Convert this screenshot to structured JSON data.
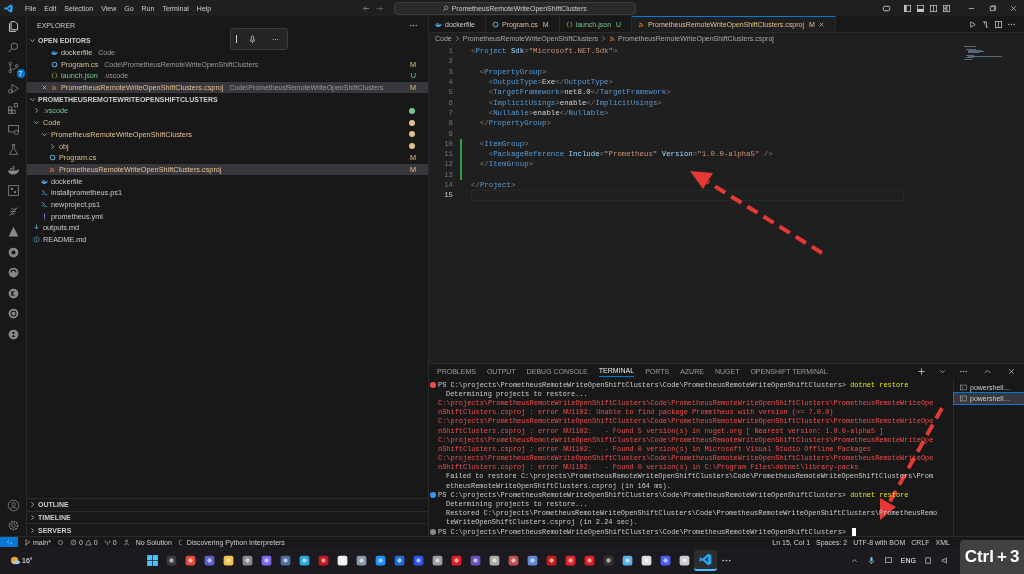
{
  "title_bar": {
    "menu": [
      "File",
      "Edit",
      "Selection",
      "View",
      "Go",
      "Run",
      "Terminal",
      "Help"
    ],
    "search": {
      "value": "PrometheusRemoteWriteOpenShiftClusters"
    }
  },
  "activity_bar": {
    "source_control_badge": "7"
  },
  "sidebar": {
    "title": "EXPLORER",
    "open_editors": {
      "title": "OPEN EDITORS",
      "expanded": true,
      "items": [
        {
          "label": "dockerfile",
          "description": "Code",
          "kind": "docker",
          "selected": false
        },
        {
          "label": "Program.cs",
          "description": "Code\\PrometheusRemoteWriteOpenShiftClusters",
          "kind": "csharp",
          "untracked": false,
          "badge": "M",
          "selected": false
        },
        {
          "label": "launch.json",
          "description": ".vscode",
          "kind": "json",
          "untracked": true,
          "badge": "U",
          "selected": false
        },
        {
          "label": "PrometheusRemoteWriteOpenShiftClusters.csproj",
          "description": "Code\\PrometheusRemoteWriteOpenShiftClusters",
          "kind": "xml",
          "untracked": false,
          "badge": "M",
          "selected": true
        }
      ]
    },
    "workspace": {
      "title": "PROMETHEUSREMOTEWRITEOPENSHIFTCLUSTERS",
      "expanded": true,
      "tree": [
        {
          "label": ".vscode",
          "kind": "folder",
          "expanded": false,
          "color": "#73c991",
          "selected": false
        },
        {
          "label": "Code",
          "kind": "folder",
          "expanded": true,
          "color": "#e2c08d",
          "selected": false,
          "children": [
            {
              "label": "PrometheusRemoteWriteOpenShiftClusters",
              "kind": "folder",
              "expanded": true,
              "color": "#e2c08d",
              "selected": false,
              "children": [
                {
                  "label": "obj",
                  "kind": "folder",
                  "expanded": false,
                  "color": "#e2c08d",
                  "selected": false
                },
                {
                  "label": "Program.cs",
                  "kind": "csharp",
                  "untracked": false,
                  "badge": "M",
                  "selected": false
                },
                {
                  "label": "PrometheusRemoteWriteOpenShiftClusters.csproj",
                  "kind": "xml",
                  "untracked": false,
                  "badge": "M",
                  "selected": true
                }
              ]
            },
            {
              "label": "dockerfile",
              "kind": "docker",
              "selected": false
            },
            {
              "label": "installprometheus.ps1",
              "kind": "powershell",
              "selected": false
            },
            {
              "label": "newproject.ps1",
              "kind": "powershell",
              "selected": false
            },
            {
              "label": "prometheus.yml",
              "kind": "yaml",
              "selected": false
            }
          ]
        },
        {
          "label": "outputs.md",
          "kind": "markdown",
          "selected": false
        },
        {
          "label": "README.md",
          "kind": "readme",
          "selected": false
        }
      ]
    },
    "sections": [
      {
        "title": "OUTLINE",
        "expanded": false
      },
      {
        "title": "TIMELINE",
        "expanded": false
      },
      {
        "title": "SERVERS",
        "expanded": false
      }
    ]
  },
  "editor": {
    "tabs": [
      {
        "label": "dockerfile",
        "kind": "docker",
        "selected": false
      },
      {
        "label": "Program.cs",
        "kind": "csharp",
        "untracked": false,
        "badge": "M",
        "selected": false
      },
      {
        "label": "launch.json",
        "kind": "json",
        "untracked": true,
        "badge": "U",
        "selected": false
      },
      {
        "label": "PrometheusRemoteWriteOpenShiftClusters.csproj",
        "kind": "xml",
        "untracked": false,
        "badge": "M",
        "selected": true
      }
    ],
    "breadcrumbs": [
      "Code",
      "PrometheusRemoteWriteOpenShiftClusters",
      "PrometheusRemoteWriteOpenShiftClusters.csproj"
    ],
    "lines": [
      {
        "number": "1",
        "changed": false,
        "current": false,
        "tokens": [
          {
            "kind": "punct",
            "text": "<"
          },
          {
            "kind": "tag",
            "text": "Project"
          },
          {
            "kind": "attr",
            "text": " Sdk"
          },
          {
            "kind": "punct",
            "text": "="
          },
          {
            "kind": "string",
            "text": "\"Microsoft.NET.Sdk\""
          },
          {
            "kind": "punct",
            "text": ">"
          }
        ]
      },
      {
        "number": "2",
        "changed": false,
        "current": false
      },
      {
        "number": "3",
        "changed": false,
        "current": false,
        "tokens": [
          {
            "kind": "punct",
            "text": "  <"
          },
          {
            "kind": "tag",
            "text": "PropertyGroup"
          },
          {
            "kind": "punct",
            "text": ">"
          }
        ]
      },
      {
        "number": "4",
        "changed": false,
        "current": false,
        "tokens": [
          {
            "kind": "punct",
            "text": "    <"
          },
          {
            "kind": "tag",
            "text": "OutputType"
          },
          {
            "kind": "punct",
            "text": ">"
          },
          {
            "kind": "text",
            "text": "Exe"
          },
          {
            "kind": "punct",
            "text": "</"
          },
          {
            "kind": "tag",
            "text": "OutputType"
          },
          {
            "kind": "punct",
            "text": ">"
          }
        ]
      },
      {
        "number": "5",
        "changed": false,
        "current": false,
        "tokens": [
          {
            "kind": "punct",
            "text": "    <"
          },
          {
            "kind": "tag",
            "text": "TargetFramework"
          },
          {
            "kind": "punct",
            "text": ">"
          },
          {
            "kind": "text",
            "text": "net8.0"
          },
          {
            "kind": "punct",
            "text": "</"
          },
          {
            "kind": "tag",
            "text": "TargetFramework"
          },
          {
            "kind": "punct",
            "text": ">"
          }
        ]
      },
      {
        "number": "6",
        "changed": false,
        "current": false,
        "tokens": [
          {
            "kind": "punct",
            "text": "    <"
          },
          {
            "kind": "tag",
            "text": "ImplicitUsings"
          },
          {
            "kind": "punct",
            "text": ">"
          },
          {
            "kind": "text",
            "text": "enable"
          },
          {
            "kind": "punct",
            "text": "</"
          },
          {
            "kind": "tag",
            "text": "ImplicitUsings"
          },
          {
            "kind": "punct",
            "text": ">"
          }
        ]
      },
      {
        "number": "7",
        "changed": false,
        "current": false,
        "tokens": [
          {
            "kind": "punct",
            "text": "    <"
          },
          {
            "kind": "tag",
            "text": "Nullable"
          },
          {
            "kind": "punct",
            "text": ">"
          },
          {
            "kind": "text",
            "text": "enable"
          },
          {
            "kind": "punct",
            "text": "</"
          },
          {
            "kind": "tag",
            "text": "Nullable"
          },
          {
            "kind": "punct",
            "text": ">"
          }
        ]
      },
      {
        "number": "8",
        "changed": false,
        "current": false,
        "tokens": [
          {
            "kind": "punct",
            "text": "  </"
          },
          {
            "kind": "tag",
            "text": "PropertyGroup"
          },
          {
            "kind": "punct",
            "text": ">"
          }
        ]
      },
      {
        "number": "9",
        "changed": false,
        "current": false
      },
      {
        "number": "10",
        "changed": true,
        "current": false,
        "tokens": [
          {
            "kind": "punct",
            "text": "  <"
          },
          {
            "kind": "tag",
            "text": "ItemGroup"
          },
          {
            "kind": "punct",
            "text": ">"
          }
        ]
      },
      {
        "number": "11",
        "changed": true,
        "current": false,
        "tokens": [
          {
            "kind": "punct",
            "text": "    <"
          },
          {
            "kind": "tag",
            "text": "PackageReference"
          },
          {
            "kind": "attr",
            "text": " Include"
          },
          {
            "kind": "punct",
            "text": "="
          },
          {
            "kind": "string",
            "text": "\"Prometheus\""
          },
          {
            "kind": "attr",
            "text": " Version"
          },
          {
            "kind": "punct",
            "text": "="
          },
          {
            "kind": "string",
            "text": "\"1.0.0-alpha5\""
          },
          {
            "kind": "punct",
            "text": " />"
          }
        ]
      },
      {
        "number": "12",
        "changed": true,
        "current": false,
        "tokens": [
          {
            "kind": "punct",
            "text": "  </"
          },
          {
            "kind": "tag",
            "text": "ItemGroup"
          },
          {
            "kind": "punct",
            "text": ">"
          }
        ]
      },
      {
        "number": "13",
        "changed": true,
        "current": false
      },
      {
        "number": "14",
        "changed": false,
        "current": false,
        "tokens": [
          {
            "kind": "punct",
            "text": "</"
          },
          {
            "kind": "tag",
            "text": "Project"
          },
          {
            "kind": "punct",
            "text": ">"
          }
        ]
      },
      {
        "number": "15",
        "changed": false,
        "current": true
      }
    ]
  },
  "panel": {
    "tabs": [
      {
        "label": "PROBLEMS",
        "selected": false
      },
      {
        "label": "OUTPUT",
        "selected": false
      },
      {
        "label": "DEBUG CONSOLE",
        "selected": false
      },
      {
        "label": "TERMINAL",
        "selected": true
      },
      {
        "label": "PORTS",
        "selected": false
      },
      {
        "label": "AZURE",
        "selected": false
      },
      {
        "label": "NUGET",
        "selected": false
      },
      {
        "label": "OPENSHIFT TERMINAL",
        "selected": false
      }
    ],
    "terminal_lines": [
      {
        "kind": "prompt",
        "color": "#f14c4c",
        "text": "PS C:\\projects\\PrometheusRemoteWriteOpenShiftClusters\\Code\\PrometheusRemoteWriteOpenShiftClusters> ",
        "command": "dotnet restore",
        "cursor": false
      },
      {
        "kind": "output",
        "text": "Determining projects to restore..."
      },
      {
        "kind": "error",
        "text": "C:\\projects\\PrometheusRemoteWriteOpenShiftClusters\\Code\\PrometheusRemoteWriteOpenShiftClusters\\PrometheusRemoteWriteOpe"
      },
      {
        "kind": "error",
        "text": "nShiftClusters.csproj : error NU1102: Unable to find package Prometheus with version (>= 7.0.0)"
      },
      {
        "kind": "error",
        "text": "C:\\projects\\PrometheusRemoteWriteOpenShiftClusters\\Code\\PrometheusRemoteWriteOpenShiftClusters\\PrometheusRemoteWriteOpe"
      },
      {
        "kind": "error",
        "text": "nShiftClusters.csproj : error NU1102:   - Found 5 version(s) in nuget.org [ Nearest version: 1.0.0-alpha5 ]"
      },
      {
        "kind": "error",
        "text": "C:\\projects\\PrometheusRemoteWriteOpenShiftClusters\\Code\\PrometheusRemoteWriteOpenShiftClusters\\PrometheusRemoteWriteOpe"
      },
      {
        "kind": "error",
        "text": "nShiftClusters.csproj : error NU1102:   - Found 0 version(s) in Microsoft Visual Studio Offline Packages"
      },
      {
        "kind": "error",
        "text": "C:\\projects\\PrometheusRemoteWriteOpenShiftClusters\\Code\\PrometheusRemoteWriteOpenShiftClusters\\PrometheusRemoteWriteOpe"
      },
      {
        "kind": "error",
        "text": "nShiftClusters.csproj : error NU1102:   - Found 0 version(s) in C:\\Program Files\\dotnet\\library-packs"
      },
      {
        "kind": "output",
        "text": "Failed to restore C:\\projects\\PrometheusRemoteWriteOpenShiftClusters\\Code\\PrometheusRemoteWriteOpenShiftClusters\\Prom"
      },
      {
        "kind": "output",
        "text": "etheusRemoteWriteOpenShiftClusters.csproj (in 164 ms)."
      },
      {
        "kind": "prompt",
        "color": "#3794ff",
        "text": "PS C:\\projects\\PrometheusRemoteWriteOpenShiftClusters\\Code\\PrometheusRemoteWriteOpenShiftClusters> ",
        "command": "dotnet restore",
        "cursor": false
      },
      {
        "kind": "output",
        "text": "Determining projects to restore..."
      },
      {
        "kind": "output",
        "text": "Restored C:\\projects\\PrometheusRemoteWriteOpenShiftClusters\\Code\\PrometheusRemoteWriteOpenShiftClusters\\PrometheusRemo"
      },
      {
        "kind": "output",
        "text": "teWriteOpenShiftClusters.csproj (in 2.24 sec)."
      },
      {
        "kind": "prompt",
        "color": "#888888",
        "text": "PS C:\\projects\\PrometheusRemoteWriteOpenShiftClusters\\Code\\PrometheusRemoteWriteOpenShiftClusters> ",
        "cursor": true
      }
    ],
    "terminals": [
      {
        "label": "powershell…",
        "selected": false
      },
      {
        "label": "powershell…",
        "selected": true
      }
    ]
  },
  "status_bar": {
    "branch": "main*",
    "errors": "0",
    "warnings": "0",
    "ports": "0",
    "solution": "No Solution",
    "progress": "Discovering Python Interpreters",
    "position": "Ln 15, Col 1",
    "indent": "Spaces: 2",
    "encoding": "UTF-8 with BOM",
    "eol": "CRLF",
    "language": "XML"
  },
  "taskbar": {
    "weather": "16°",
    "language": "ENG"
  },
  "key_overlay": {
    "keys": [
      "Ctrl",
      "+",
      "3"
    ]
  }
}
